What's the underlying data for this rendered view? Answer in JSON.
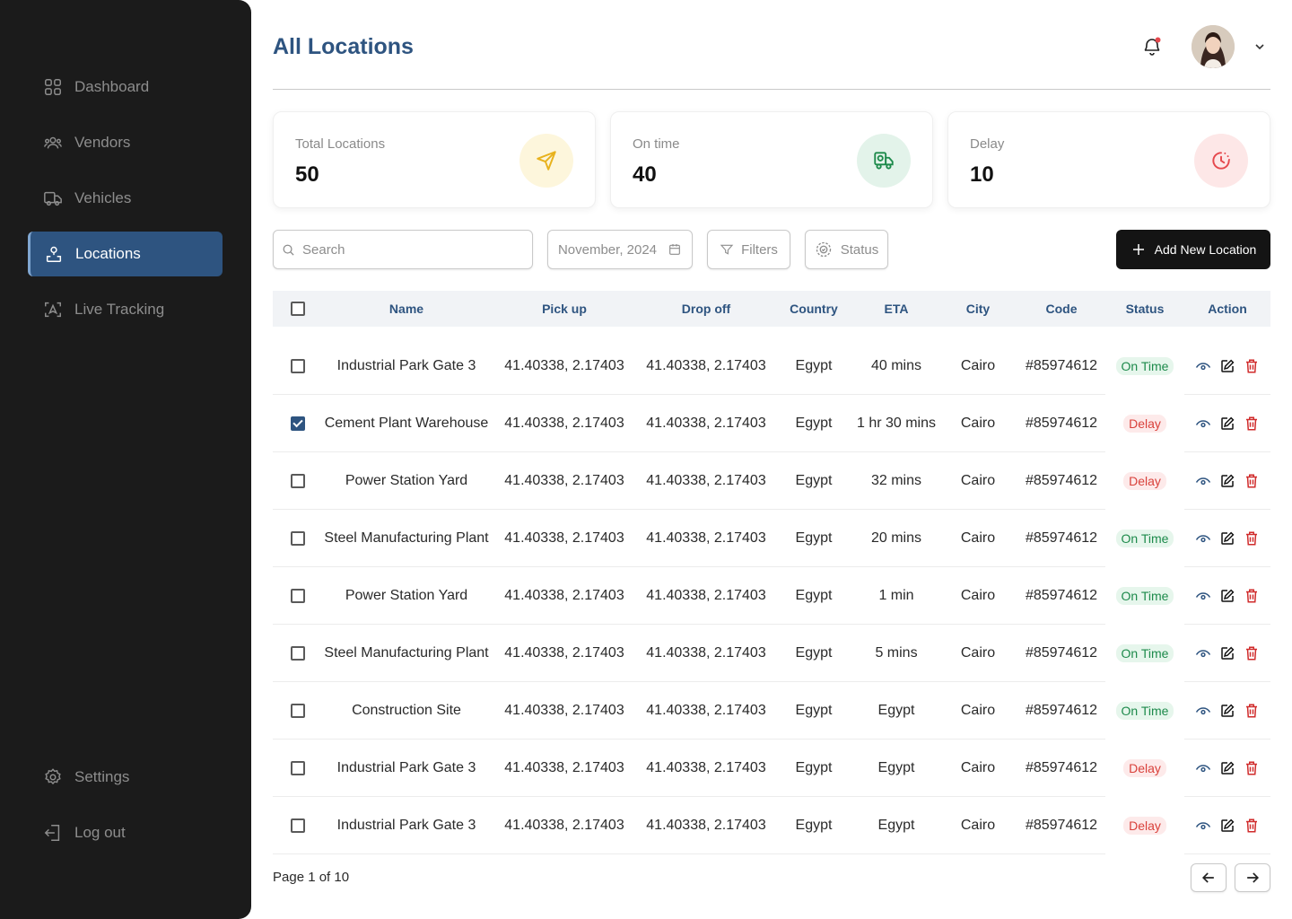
{
  "sidebar": {
    "items": [
      {
        "label": "Dashboard",
        "icon": "grid-icon"
      },
      {
        "label": "Vendors",
        "icon": "users-icon"
      },
      {
        "label": "Vehicles",
        "icon": "truck-icon"
      },
      {
        "label": "Locations",
        "icon": "location-user-icon",
        "active": true
      },
      {
        "label": "Live Tracking",
        "icon": "tracking-icon"
      }
    ],
    "settings_label": "Settings",
    "logout_label": "Log out"
  },
  "header": {
    "title": "All Locations",
    "notification_dot_color": "#e5484d"
  },
  "stats": [
    {
      "label": "Total Locations",
      "value": "50",
      "icon": "send-icon",
      "icon_color": "#e8b21d",
      "bg": "#fdf6dc"
    },
    {
      "label": "On time",
      "value": "40",
      "icon": "delivery-truck-icon",
      "icon_color": "#1d8a4b",
      "bg": "#e3f3ea"
    },
    {
      "label": "Delay",
      "value": "10",
      "icon": "clock-alert-icon",
      "icon_color": "#e5484d",
      "bg": "#fde7e7"
    }
  ],
  "toolbar": {
    "search_placeholder": "Search",
    "date_label": "November, 2024",
    "filters_label": "Filters",
    "status_label": "Status",
    "add_label": "Add New Location"
  },
  "table": {
    "columns": [
      "Name",
      "Pick up",
      "Drop off",
      "Country",
      "ETA",
      "City",
      "Code",
      "Status",
      "Action"
    ],
    "rows": [
      {
        "checked": false,
        "name": "Industrial Park Gate 3",
        "pickup": "41.40338, 2.17403",
        "dropoff": "41.40338, 2.17403",
        "country": "Egypt",
        "eta": "40 mins",
        "city": "Cairo",
        "code": "#85974612",
        "status": "On Time"
      },
      {
        "checked": true,
        "name": "Cement Plant Warehouse",
        "pickup": "41.40338, 2.17403",
        "dropoff": "41.40338, 2.17403",
        "country": "Egypt",
        "eta": "1 hr 30 mins",
        "city": "Cairo",
        "code": "#85974612",
        "status": "Delay"
      },
      {
        "checked": false,
        "name": "Power Station Yard",
        "pickup": "41.40338, 2.17403",
        "dropoff": "41.40338, 2.17403",
        "country": "Egypt",
        "eta": "32 mins",
        "city": "Cairo",
        "code": "#85974612",
        "status": "Delay"
      },
      {
        "checked": false,
        "name": "Steel Manufacturing Plant",
        "pickup": "41.40338, 2.17403",
        "dropoff": "41.40338, 2.17403",
        "country": "Egypt",
        "eta": "20 mins",
        "city": "Cairo",
        "code": "#85974612",
        "status": "On Time"
      },
      {
        "checked": false,
        "name": "Power Station Yard",
        "pickup": "41.40338, 2.17403",
        "dropoff": "41.40338, 2.17403",
        "country": "Egypt",
        "eta": "1 min",
        "city": "Cairo",
        "code": "#85974612",
        "status": "On Time"
      },
      {
        "checked": false,
        "name": "Steel Manufacturing Plant",
        "pickup": "41.40338, 2.17403",
        "dropoff": "41.40338, 2.17403",
        "country": "Egypt",
        "eta": "5 mins",
        "city": "Cairo",
        "code": "#85974612",
        "status": "On Time"
      },
      {
        "checked": false,
        "name": "Construction Site",
        "pickup": "41.40338, 2.17403",
        "dropoff": "41.40338, 2.17403",
        "country": "Egypt",
        "eta": "Egypt",
        "city": "Cairo",
        "code": "#85974612",
        "status": "On Time"
      },
      {
        "checked": false,
        "name": "Industrial Park Gate 3",
        "pickup": "41.40338, 2.17403",
        "dropoff": "41.40338, 2.17403",
        "country": "Egypt",
        "eta": "Egypt",
        "city": "Cairo",
        "code": "#85974612",
        "status": "Delay"
      },
      {
        "checked": false,
        "name": "Industrial Park Gate 3",
        "pickup": "41.40338, 2.17403",
        "dropoff": "41.40338, 2.17403",
        "country": "Egypt",
        "eta": "Egypt",
        "city": "Cairo",
        "code": "#85974612",
        "status": "Delay"
      }
    ]
  },
  "pagination": {
    "label": "Page 1 of 10"
  },
  "colors": {
    "accent": "#2e5480",
    "sidebar_bg": "#1b1b1b",
    "on_time": "#1d8a4b",
    "delay": "#d9413b",
    "delete": "#d02b2b"
  }
}
